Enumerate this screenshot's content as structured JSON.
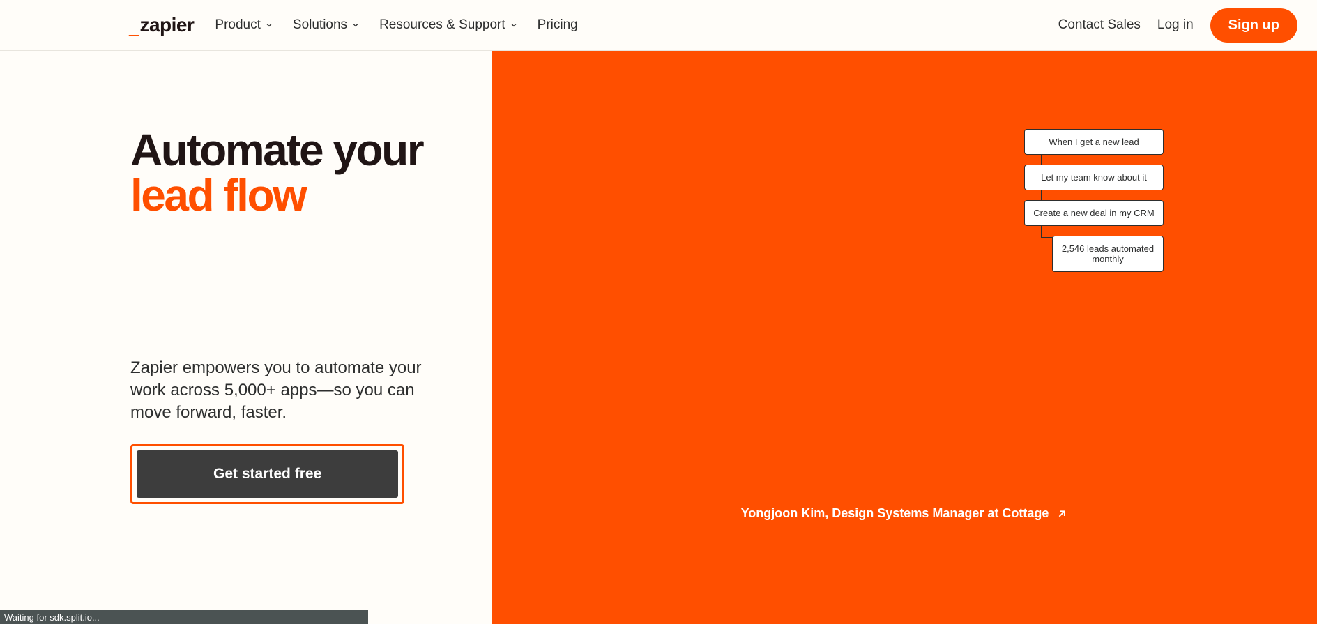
{
  "nav": {
    "logo_text": "zapier",
    "items": [
      {
        "label": "Product",
        "has_chevron": true
      },
      {
        "label": "Solutions",
        "has_chevron": true
      },
      {
        "label": "Resources & Support",
        "has_chevron": true
      },
      {
        "label": "Pricing",
        "has_chevron": false
      }
    ],
    "contact": "Contact Sales",
    "login": "Log in",
    "signup": "Sign up"
  },
  "hero": {
    "title_line1": "Automate your",
    "title_line2": "lead flow",
    "subtitle": "Zapier empowers you to automate your work across 5,000+ apps—so you can move forward, faster.",
    "cta": "Get started free"
  },
  "flow": {
    "cards": [
      "When I get a new lead",
      "Let my team know about it",
      "Create a new deal in my CRM",
      "2,546 leads automated monthly"
    ]
  },
  "testimonial": {
    "text": "Yongjoon Kim, Design Systems Manager at Cottage"
  },
  "status": {
    "text": "Waiting for sdk.split.io..."
  }
}
